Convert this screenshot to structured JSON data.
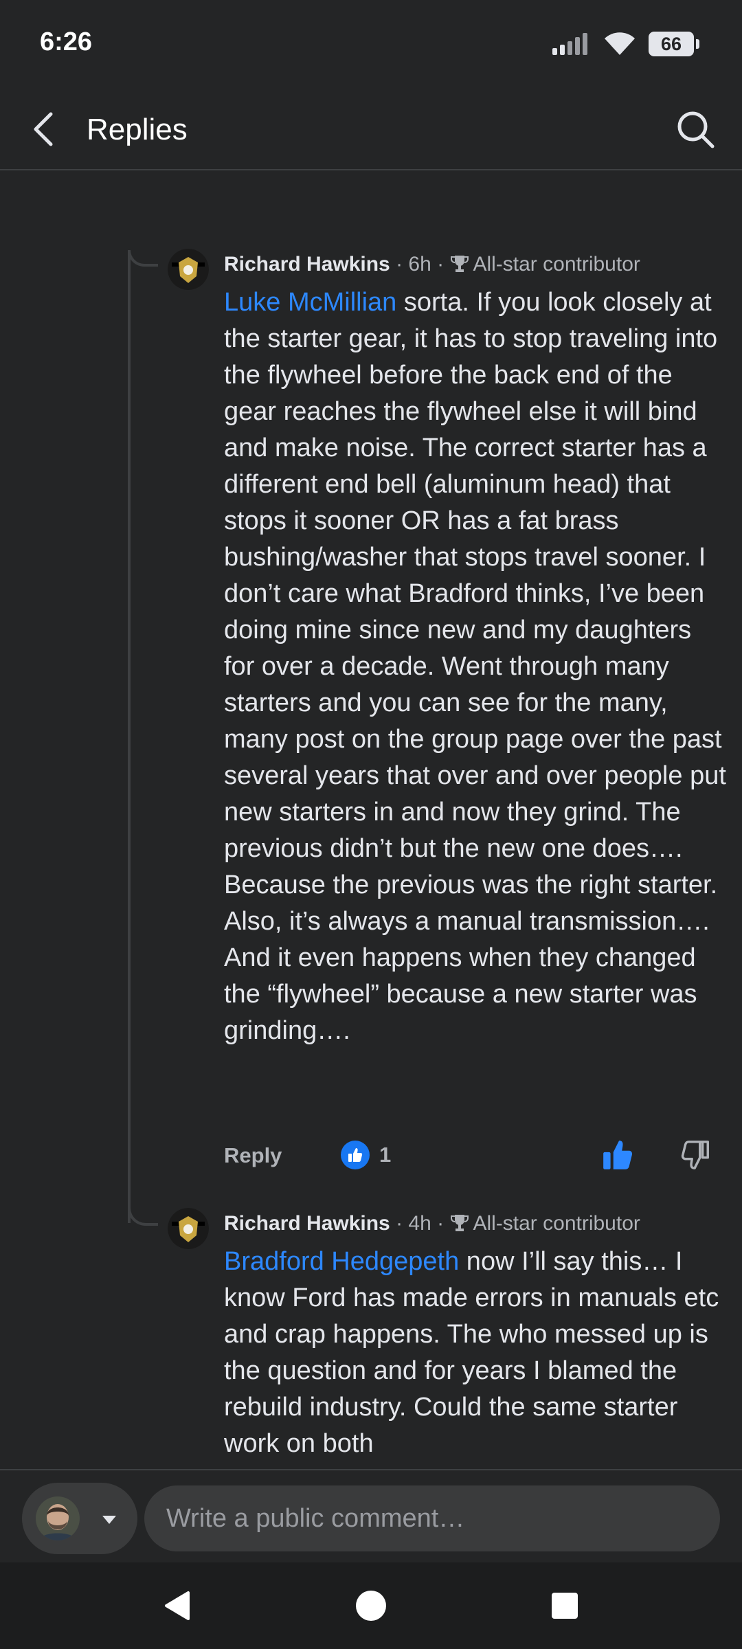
{
  "status_bar": {
    "time": "6:26",
    "battery": "66"
  },
  "header": {
    "title": "Replies"
  },
  "comments": [
    {
      "author": "Richard Hawkins",
      "time": " · 6h · ",
      "badge": "All-star contributor",
      "mention": "Luke McMillian",
      "text": " sorta. If you look closely at the starter gear, it has to stop traveling into the flywheel before the back end of the gear reaches the flywheel else it will bind and make noise. The correct starter has a different end bell (aluminum head) that stops it sooner OR has a fat brass bushing/washer that stops travel sooner. I don’t care what Bradford thinks, I’ve been doing mine since new and my daughters for over a decade. Went through many starters and you can see for the many, many post on the group page over the past several years that over and over people put new starters in and now they grind. The previous didn’t but the new one does…. Because the previous was the right starter. Also, it’s always a manual transmission…. And it even happens when they changed the “flywheel” because a new starter was grinding….",
      "reply_label": "Reply",
      "reaction_count": "1"
    },
    {
      "author": "Richard Hawkins",
      "time": " · 4h · ",
      "badge": "All-star contributor",
      "mention": "Bradford Hedgepeth",
      "text": " now I’ll say this… I know Ford has made errors in manuals etc and crap happens. The who messed up is the question and for years I blamed the rebuild industry. Could the same starter work on both"
    }
  ],
  "composer": {
    "placeholder": "Write a public comment…"
  },
  "icons": {
    "back": "chevron-left-icon",
    "search": "search-icon",
    "badge": "trophy-icon",
    "like": "thumbs-up-icon",
    "dislike": "thumbs-down-icon"
  },
  "colors": {
    "background": "#242526",
    "mention": "#2d88ff",
    "like": "#1877f2",
    "text": "#e4e6eb",
    "muted": "#b0b3b8"
  }
}
